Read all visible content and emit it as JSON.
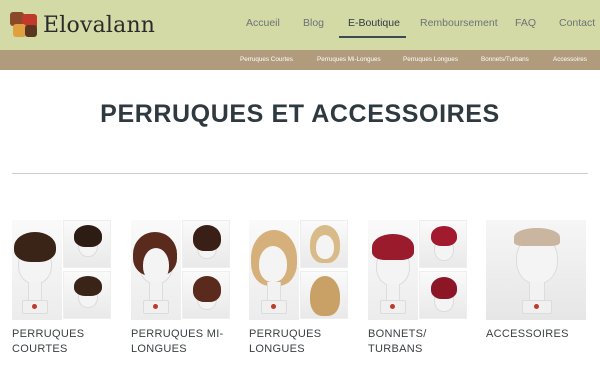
{
  "brand": {
    "name": "Elovalann"
  },
  "nav": {
    "items": [
      {
        "label": "Accueil"
      },
      {
        "label": "Blog"
      },
      {
        "label": "E-Boutique",
        "active": true
      },
      {
        "label": "Remboursement"
      },
      {
        "label": "FAQ"
      },
      {
        "label": "Contact"
      }
    ]
  },
  "subnav": {
    "items": [
      {
        "label": "Perruques Courtes"
      },
      {
        "label": "Perruques Mi-Longues"
      },
      {
        "label": "Perruques Longues"
      },
      {
        "label": "Bonnets/Turbans"
      },
      {
        "label": "Accessoires"
      }
    ]
  },
  "page": {
    "title": "PERRUQUES ET ACCESSOIRES"
  },
  "categories": [
    {
      "line1": "PERRUQUES",
      "line2": "COURTES",
      "hair_color": "#3a2418"
    },
    {
      "line1": "PERRUQUES MI-",
      "line2": "LONGUES",
      "hair_color": "#5a2a1c"
    },
    {
      "line1": "PERRUQUES",
      "line2": "LONGUES",
      "hair_color": "#d6b07a"
    },
    {
      "line1": "BONNETS/",
      "line2": "TURBANS",
      "hair_color": "#9a1c2c"
    },
    {
      "line1": "ACCESSOIRES",
      "line2": "",
      "hair_color": "#c9b5a0"
    }
  ],
  "colors": {
    "header_bg": "#d3daa6",
    "subnav_bg": "#b09b7c",
    "text_dark": "#2f3a40"
  }
}
